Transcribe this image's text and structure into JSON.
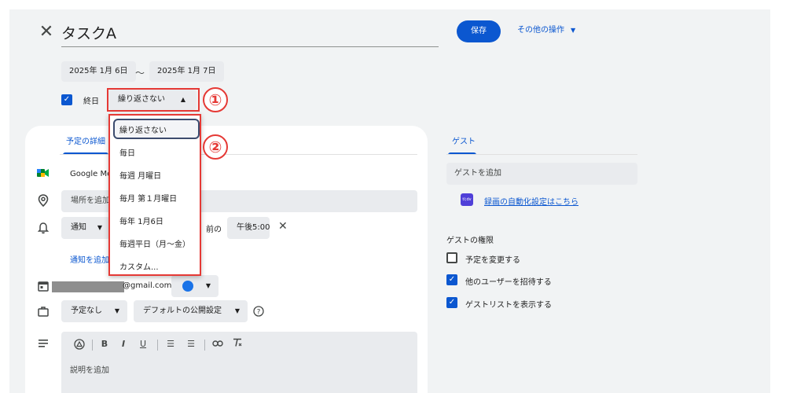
{
  "header": {
    "close_glyph": "✕",
    "title_value": "タスクA",
    "save_label": "保存",
    "more_actions_label": "その他の操作"
  },
  "dates": {
    "start": "2025年 1月 6日",
    "separator": "〜",
    "end": "2025年 1月 7日"
  },
  "all_day": {
    "checked": true,
    "label": "終日"
  },
  "repeat": {
    "selected_label": "繰り返さない",
    "options": [
      "繰り返さない",
      "毎日",
      "毎週 月曜日",
      "毎月 第１月曜日",
      "毎年 1月6日",
      "毎週平日（月〜金）",
      "カスタム..."
    ]
  },
  "annotations": {
    "badge1": "①",
    "badge2": "②",
    "highlight_color": "#e53935"
  },
  "tabs": {
    "event_details": "予定の詳細",
    "guests": "ゲスト"
  },
  "details": {
    "meet_label": "Google Meet",
    "location_placeholder": "場所を追加",
    "notification_type": "通知",
    "notification_before": "前の",
    "notification_time": "午後5:00",
    "remove_glyph": "✕",
    "add_notification": "通知を追加",
    "calendar_email_suffix": "@gmail.com",
    "availability": "予定なし",
    "visibility": "デフォルトの公開設定",
    "description_placeholder": "説明を追加"
  },
  "guests_panel": {
    "add_guest_placeholder": "ゲストを追加",
    "recording_link": "録画の自動化設定はこちら",
    "recording_icon_text": "tl;dv",
    "permissions_title": "ゲストの権限",
    "permissions": [
      {
        "label": "予定を変更する",
        "checked": false
      },
      {
        "label": "他のユーザーを招待する",
        "checked": true
      },
      {
        "label": "ゲストリストを表示する",
        "checked": true
      }
    ]
  },
  "icons": {
    "meet": "meet-icon",
    "location": "location-pin-icon",
    "bell": "bell-icon",
    "calendar": "calendar-icon",
    "briefcase": "briefcase-icon",
    "description": "description-icon",
    "help": "help-icon"
  },
  "colors": {
    "accent": "#0b57d0",
    "panel_bg": "#f1f3f4",
    "calendar_color": "#1a73e8"
  }
}
